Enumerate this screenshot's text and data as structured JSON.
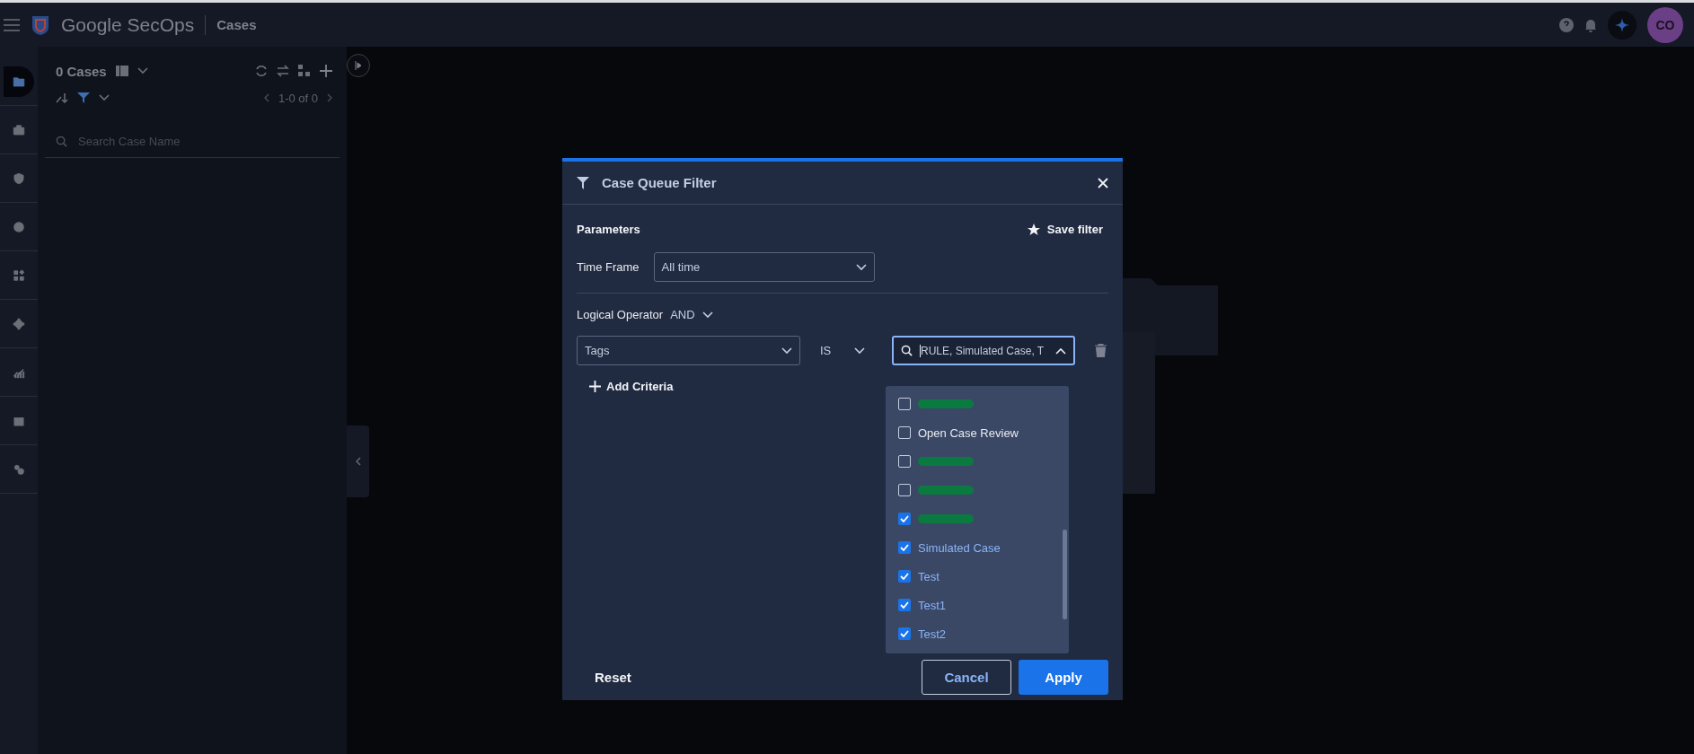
{
  "top_bar": {
    "brand": "Google SecOps",
    "page_title": "Cases",
    "avatar": "CO"
  },
  "nav_rail": {
    "items": [
      {
        "selected": true
      },
      {
        "selected": false
      },
      {
        "selected": false
      },
      {
        "selected": false
      },
      {
        "selected": false
      },
      {
        "selected": false
      },
      {
        "selected": false
      },
      {
        "selected": false
      },
      {
        "selected": false
      }
    ]
  },
  "case_panel": {
    "count": "0 Cases",
    "pagination": "1-0 of 0",
    "search": {
      "placeholder": "Search Case Name"
    }
  },
  "dialog": {
    "title": "Case Queue Filter",
    "section": "Parameters",
    "save_filter": "Save filter",
    "time_frame": {
      "label": "Time Frame",
      "value": "All time"
    },
    "logical_operator": {
      "label": "Logical Operator",
      "value": "AND"
    },
    "criteria": [
      {
        "field": "Tags",
        "operator": "IS",
        "search_value": "RULE, Simulated Case, T"
      }
    ],
    "add_criteria": "Add Criteria",
    "options": [
      {
        "kind": "redacted",
        "checked": false
      },
      {
        "kind": "text",
        "label": "Open Case Review",
        "checked": false
      },
      {
        "kind": "redacted",
        "checked": false
      },
      {
        "kind": "redacted",
        "checked": false
      },
      {
        "kind": "redacted",
        "checked": true
      },
      {
        "kind": "text",
        "label": "Simulated Case",
        "checked": true
      },
      {
        "kind": "text",
        "label": "Test",
        "checked": true
      },
      {
        "kind": "text",
        "label": "Test1",
        "checked": true
      },
      {
        "kind": "text",
        "label": "Test2",
        "checked": true
      }
    ],
    "buttons": {
      "reset": "Reset",
      "cancel": "Cancel",
      "apply": "Apply"
    }
  }
}
